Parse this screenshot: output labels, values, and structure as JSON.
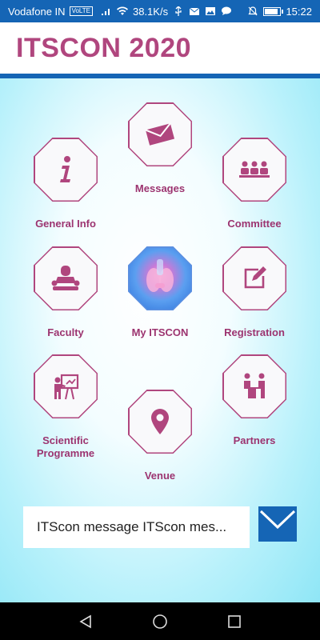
{
  "status_bar": {
    "carrier": "Vodafone IN",
    "network_badge": "VoLTE",
    "speed": "38.1K/s",
    "time": "15:22"
  },
  "header": {
    "title": "ITSCON 2020"
  },
  "tiles": {
    "messages": {
      "label": "Messages",
      "icon": "envelope-icon"
    },
    "general_info": {
      "label": "General Info",
      "icon": "info-icon"
    },
    "committee": {
      "label": "Committee",
      "icon": "group-icon"
    },
    "faculty": {
      "label": "Faculty",
      "icon": "speaker-icon"
    },
    "my_itscon": {
      "label": "My ITSCON",
      "icon": "thyroid-image"
    },
    "registration": {
      "label": "Registration",
      "icon": "edit-icon"
    },
    "scientific_programme": {
      "label": "Scientific Programme",
      "icon": "presenter-icon"
    },
    "venue": {
      "label": "Venue",
      "icon": "location-pin-icon"
    },
    "partners": {
      "label": "Partners",
      "icon": "partners-icon"
    }
  },
  "message_bar": {
    "text": "ITScon message ITScon mes...",
    "button_icon": "envelope-icon"
  },
  "colors": {
    "brand": "#b0467e",
    "label": "#9c3470",
    "primary_blue": "#1565b5"
  }
}
